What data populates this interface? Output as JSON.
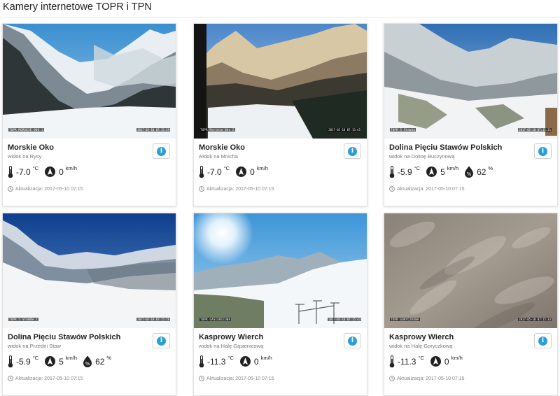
{
  "page_title": "Kamery internetowe TOPR i TPN",
  "icons": {
    "temperature": "thermometer-icon",
    "wind": "wind-direction-icon",
    "humidity": "humidity-icon",
    "updated": "clock-icon",
    "info": "info-icon"
  },
  "colors": {
    "info_button": "#2a9fd6",
    "muted_text": "#888888"
  },
  "cards": [
    {
      "name": "Morskie Oko",
      "view": "widok na Rysy",
      "cam_label": "TOPR MORSKIE OKO 1",
      "cam_time": "2017-05-10 07:15:39",
      "temp": "-7.0",
      "temp_unit": "°C",
      "wind": "0",
      "wind_unit": "km/h",
      "updated": "Aktualizacja: 2017-05-10 07:15"
    },
    {
      "name": "Morskie Oko",
      "view": "widok na Mnicha",
      "cam_label": "TOPR Morskie Oko 2",
      "cam_time": "2017-05-10 07:15:45",
      "temp": "-7.0",
      "temp_unit": "°C",
      "wind": "0",
      "wind_unit": "km/h",
      "updated": "Aktualizacja: 2017-05-10 07:15"
    },
    {
      "name": "Dolina Pięciu Stawów Polskich",
      "view": "widok na Dolinę Buczynową",
      "cam_label": "TOPR 5 Stawow",
      "cam_time": "2017-05-10 07:15:31",
      "temp": "-5.9",
      "temp_unit": "°C",
      "wind": "5",
      "wind_unit": "km/h",
      "humidity": "62",
      "humidity_unit": "%",
      "updated": "Aktualizacja: 2017-05-10 07:15"
    },
    {
      "name": "Dolina Pięciu Stawów Polskich",
      "view": "widok na Przedni Staw",
      "cam_label": "TOPR 5 STAWOW 2",
      "cam_time": "2017-05-10 07:15:28",
      "temp": "-5.9",
      "temp_unit": "°C",
      "wind": "5",
      "wind_unit": "km/h",
      "humidity": "62",
      "humidity_unit": "%",
      "updated": "Aktualizacja: 2017-05-10 07:15"
    },
    {
      "name": "Kasprowy Wierch",
      "view": "widok na Halę Gąsienicową",
      "cam_label": "TOPR GASIENICOWA",
      "cam_time": "2017-05-10 07:15:43",
      "temp": "-11.3",
      "temp_unit": "°C",
      "wind": "0",
      "wind_unit": "km/h",
      "updated": "Aktualizacja: 2017-05-10 07:15"
    },
    {
      "name": "Kasprowy Wierch",
      "view": "widok na Halę Goryczkową",
      "cam_label": "TOPR GORYCZKOWA",
      "cam_time": "2017-05-10 07:15:33",
      "temp": "-11.3",
      "temp_unit": "°C",
      "wind": "0",
      "wind_unit": "km/h",
      "updated": "Aktualizacja: 2017-05-10 07:15"
    }
  ]
}
